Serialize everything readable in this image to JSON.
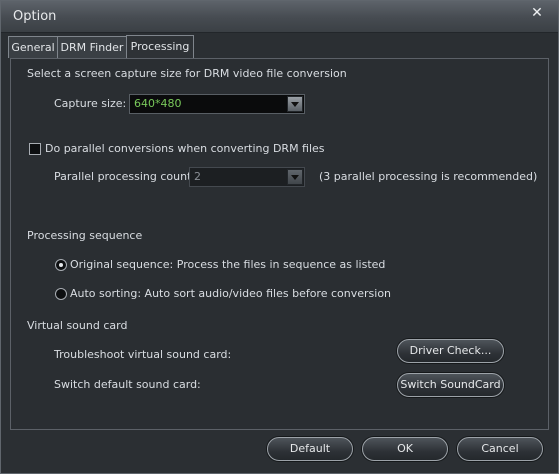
{
  "window": {
    "title": "Option",
    "close_glyph": "✕"
  },
  "tabs": [
    {
      "label": "General"
    },
    {
      "label": "DRM Finder"
    },
    {
      "label": "Processing",
      "active": true
    }
  ],
  "capture": {
    "description": "Select a screen capture size for DRM video file conversion",
    "label": "Capture size:",
    "value": "640*480",
    "value_color": "#79c95b"
  },
  "parallel": {
    "checkbox_label": "Do parallel conversions when converting DRM files",
    "checked": false,
    "count_label": "Parallel processing count:",
    "count_value": "2",
    "note": "(3 parallel processing is recommended)"
  },
  "sequence": {
    "heading": "Processing sequence",
    "options": [
      {
        "label": "Original sequence: Process the files in sequence as listed",
        "selected": true
      },
      {
        "label": "Auto sorting: Auto sort audio/video files before conversion",
        "selected": false
      }
    ]
  },
  "sound": {
    "heading": "Virtual sound card",
    "troubleshoot_label": "Troubleshoot virtual sound card:",
    "driver_check_button": "Driver Check...",
    "switch_label": "Switch default sound card:",
    "switch_button": "Switch SoundCard"
  },
  "footer": {
    "default_button": "Default",
    "ok_button": "OK",
    "cancel_button": "Cancel"
  }
}
